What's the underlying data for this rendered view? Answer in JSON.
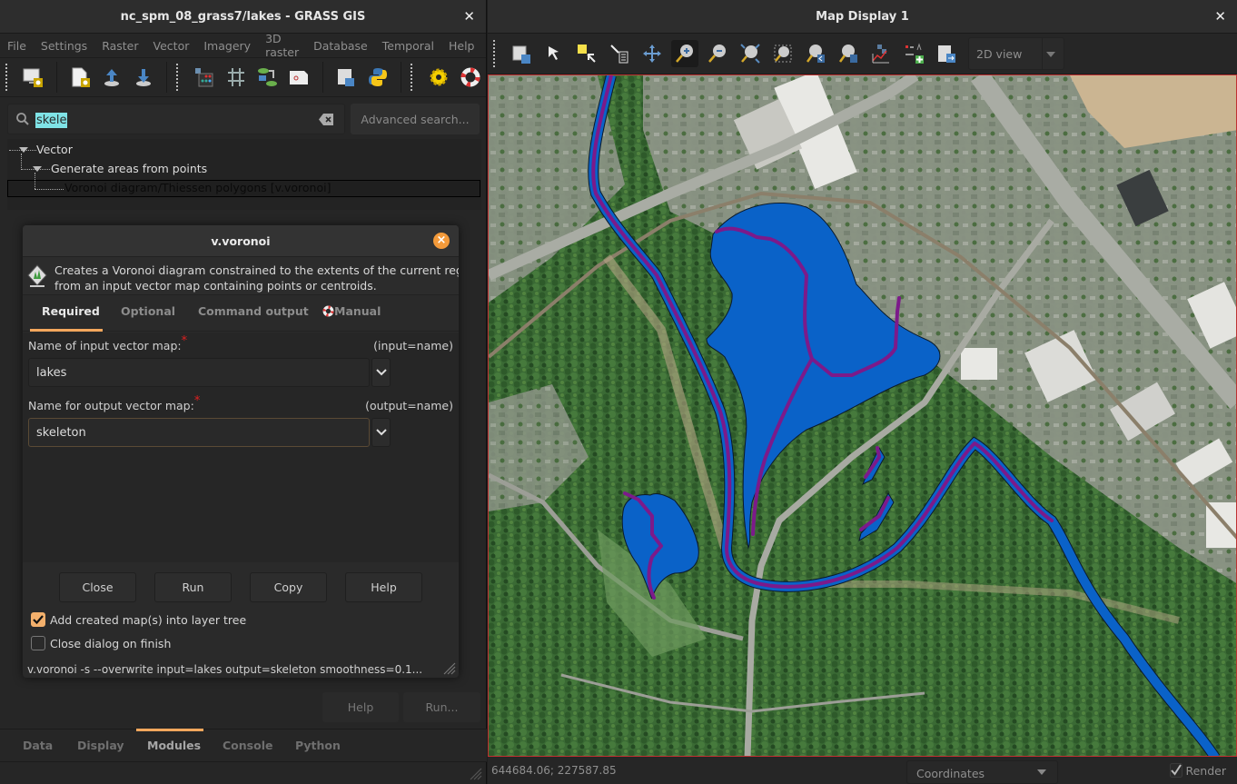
{
  "main_window": {
    "title": "nc_spm_08_grass7/lakes - GRASS GIS",
    "close_icon": "close-icon",
    "menu": [
      "File",
      "Settings",
      "Raster",
      "Vector",
      "Imagery",
      "3D raster",
      "Database",
      "Temporal",
      "Help"
    ],
    "toolbar_icons": [
      "new-map-display-icon",
      "new-workspace-icon",
      "open-workspace-icon",
      "save-workspace-icon",
      "raster-map-calculator-icon",
      "georectifier-icon",
      "graphical-modeler-icon",
      "cartographic-composer-icon",
      "launch-script-icon",
      "python-shell-icon",
      "settings-gear-icon",
      "help-lifebuoy-icon"
    ],
    "search": {
      "value": "skele",
      "placeholder": "",
      "advanced_label": "Advanced search..."
    },
    "tree": {
      "level1": "Vector",
      "level2": "Generate areas from points",
      "level3": "Voronoi diagram/Thiessen polygons   [v.voronoi]"
    },
    "footer_buttons": {
      "help": "Help",
      "run": "Run..."
    },
    "bottom_tabs": [
      "Data",
      "Display",
      "Modules",
      "Console",
      "Python"
    ],
    "active_bottom_tab": "Modules"
  },
  "dialog": {
    "title": "v.voronoi",
    "description_line1": "Creates a Voronoi diagram constrained to the extents of the current regio",
    "description_line2": "from an input vector map containing points or centroids.",
    "tabs": [
      "Required",
      "Optional",
      "Command output",
      "Manual"
    ],
    "active_tab": "Required",
    "fields": [
      {
        "label": "Name of input vector map:",
        "param": "(input=name)",
        "value": "lakes",
        "required": true
      },
      {
        "label": "Name for output vector map:",
        "param": "(output=name)",
        "value": "skeleton",
        "required": true
      }
    ],
    "buttons": {
      "close": "Close",
      "run": "Run",
      "copy": "Copy",
      "help": "Help"
    },
    "checkboxes": [
      {
        "label": "Add created map(s) into layer tree",
        "checked": true
      },
      {
        "label": "Close dialog on finish",
        "checked": false
      }
    ],
    "command": "v.voronoi -s --overwrite input=lakes output=skeleton smoothness=0.1..."
  },
  "map_window": {
    "title": "Map Display 1",
    "toolbar_icons": [
      "display-map-icon",
      "pointer-icon",
      "select-vector-icon",
      "query-icon",
      "pan-icon",
      "zoom-in-icon",
      "zoom-out-icon",
      "zoom-extent-icon",
      "zoom-region-icon",
      "zoom-back-icon",
      "zoom-menu-icon",
      "analyze-icon",
      "decorations-icon",
      "save-image-icon"
    ],
    "view_mode": "2D view",
    "status": {
      "coordinates": "644684.06; 227587.85",
      "mode_select": "Coordinates",
      "render_label": "Render",
      "render_checked": true
    },
    "layers": {
      "lake_fill": "#0a62c8",
      "skeleton_line": "#7c1a8a",
      "region_border": "#c03030"
    }
  }
}
